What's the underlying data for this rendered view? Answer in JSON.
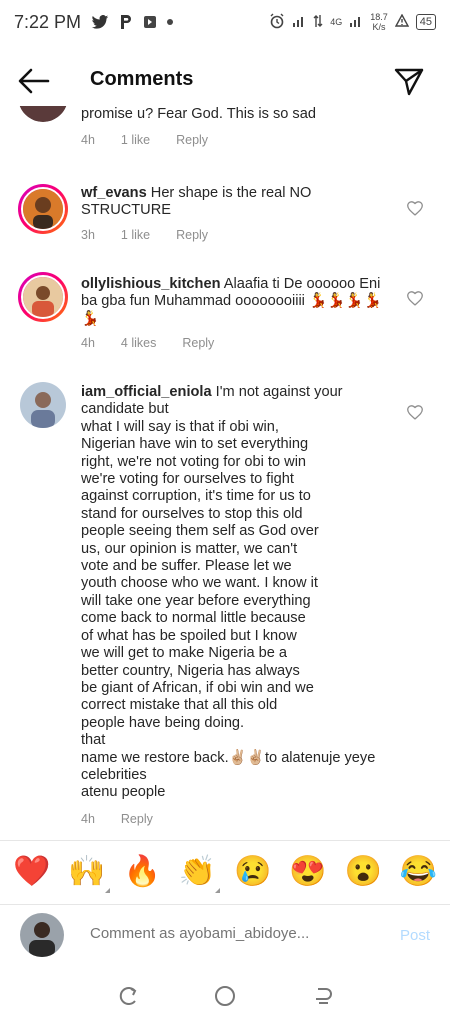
{
  "status_bar": {
    "time": "7:22 PM",
    "network": "4G",
    "speed_value": "18.7",
    "speed_unit": "K/s",
    "battery": "45"
  },
  "header": {
    "title": "Comments"
  },
  "comments": [
    {
      "username": "",
      "text": "promise u? Fear God. This is so sad",
      "time": "4h",
      "likes": "1 like",
      "reply": "Reply"
    },
    {
      "username": "wf_evans",
      "text": " Her shape is the real NO STRUCTURE",
      "time": "3h",
      "likes": "1 like",
      "reply": "Reply"
    },
    {
      "username": "ollylishious_kitchen",
      "text": " Alaafia ti De oooooo Eni ba gba fun Muhammad oooooooiiii 💃💃💃💃💃",
      "time": "4h",
      "likes": "4 likes",
      "reply": "Reply"
    },
    {
      "username": "iam_official_eniola",
      "text": " I'm not against your candidate but\nwhat I will say is that if obi win,\nNigerian have win to set everything\nright, we're not voting for obi to win\nwe're voting for ourselves to fight\nagainst corruption, it's time for us to\nstand for ourselves to stop this old\npeople seeing them self as God over\nus, our opinion is matter, we can't\nvote and be suffer. Please let we\nyouth choose who we want. I know it\nwill take one year before everything\ncome back to normal little because\nof what has be spoiled but I know\nwe will get to make Nigeria be a\nbetter country, Nigeria has always\nbe giant of African, if obi win and we\ncorrect mistake that all this old\npeople have being doing.\nthat\nname we restore back.✌🏼✌🏼to alatenuje yeye\ncelebrities\natenu people",
      "time": "4h",
      "reply": "Reply"
    }
  ],
  "emoji_bar": [
    "❤️",
    "🙌",
    "🔥",
    "👏",
    "😢",
    "😍",
    "😮",
    "😂"
  ],
  "composer": {
    "placeholder": "Comment as ayobami_abidoye...",
    "post_label": "Post"
  }
}
